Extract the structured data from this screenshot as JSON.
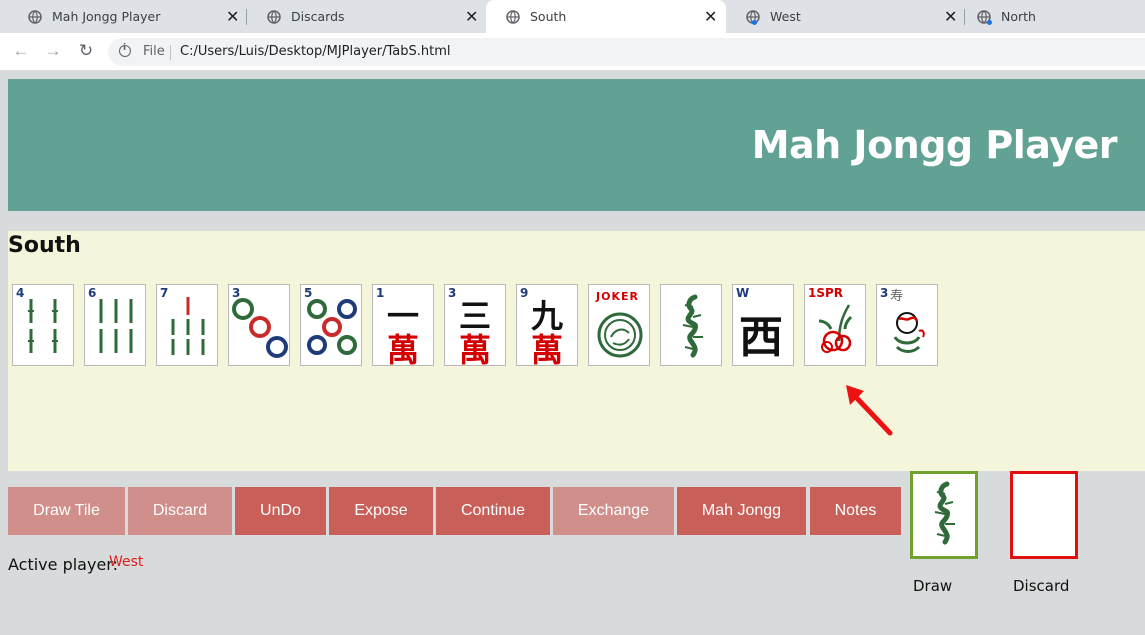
{
  "browser": {
    "tabs": [
      {
        "label": "Mah Jongg Player",
        "active": false
      },
      {
        "label": "Discards",
        "active": false
      },
      {
        "label": "South",
        "active": true
      },
      {
        "label": "West",
        "active": false
      },
      {
        "label": "North",
        "active": false
      }
    ],
    "file_label": "File",
    "url": "C:/Users/Luis/Desktop/MJPlayer/TabS.html"
  },
  "header": {
    "title": "Mah Jongg Player"
  },
  "hand": {
    "player": "South",
    "tiles": [
      {
        "name": "4 Bamboo",
        "index": "4"
      },
      {
        "name": "6 Bamboo",
        "index": "6"
      },
      {
        "name": "7 Bamboo",
        "index": "7"
      },
      {
        "name": "3 Dot",
        "index": "3"
      },
      {
        "name": "5 Dot",
        "index": "5"
      },
      {
        "name": "1 Crack",
        "index": "1",
        "chars": [
          "一",
          "萬"
        ]
      },
      {
        "name": "3 Crack",
        "index": "3",
        "chars": [
          "三",
          "萬"
        ]
      },
      {
        "name": "9 Crack",
        "index": "9",
        "chars": [
          "九",
          "萬"
        ]
      },
      {
        "name": "Joker",
        "text": "JOKER"
      },
      {
        "name": "Green Dragon"
      },
      {
        "name": "West Wind",
        "index": "W",
        "chars": [
          "西"
        ]
      },
      {
        "name": "Spring Flower",
        "index": "1SPR"
      },
      {
        "name": "Flower",
        "index": "3",
        "chars": [
          "寿"
        ]
      }
    ]
  },
  "actions": {
    "buttons": [
      {
        "label": "Draw Tile",
        "enabled": false
      },
      {
        "label": "Discard",
        "enabled": false
      },
      {
        "label": "UnDo",
        "enabled": true
      },
      {
        "label": "Expose",
        "enabled": true
      },
      {
        "label": "Continue",
        "enabled": true
      },
      {
        "label": "Exchange",
        "enabled": false
      },
      {
        "label": "Mah Jongg",
        "enabled": true
      },
      {
        "label": "Notes",
        "enabled": true
      }
    ],
    "active_player_label": "Active player:",
    "active_player": "West"
  },
  "draw": {
    "label": "Draw",
    "tile": "Green Dragon"
  },
  "discard": {
    "label": "Discard"
  },
  "colors": {
    "header_bg": "#62a295",
    "panel_bg": "#f5f5dc",
    "button_enabled": "#c95f59",
    "button_disabled": "#d08f8a",
    "draw_border": "#73a12f",
    "discard_border": "#e01010",
    "active_player": "#e02020"
  }
}
